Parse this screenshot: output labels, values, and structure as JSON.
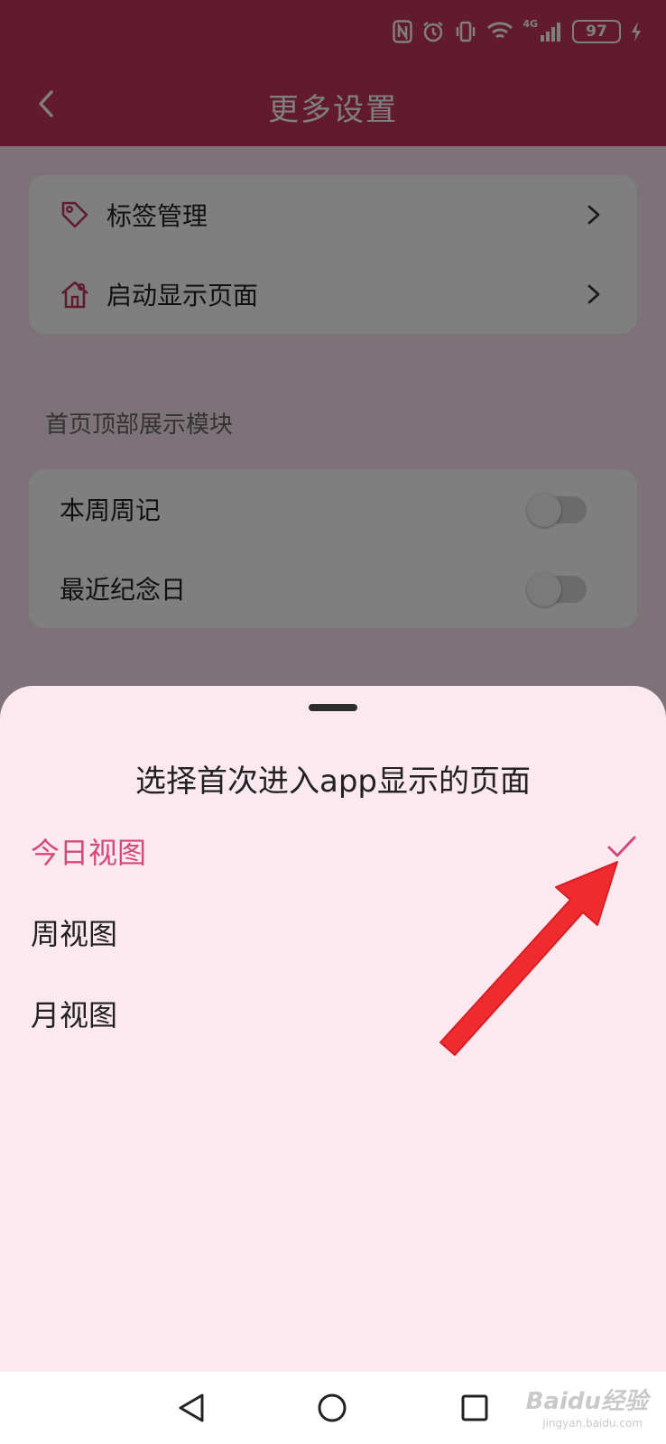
{
  "status_bar": {
    "battery": "97",
    "network": "4G",
    "icons": [
      "nfc-icon",
      "alarm-icon",
      "vibrate-icon",
      "wifi-icon",
      "signal-icon",
      "battery-icon",
      "charging-icon"
    ]
  },
  "header": {
    "title": "更多设置",
    "back_icon": "chevron-left-icon",
    "background_color": "#c4345e"
  },
  "settings_card": {
    "items": [
      {
        "label": "标签管理",
        "icon": "tag-icon"
      },
      {
        "label": "启动显示页面",
        "icon": "home-icon"
      }
    ]
  },
  "top_modules": {
    "section_label": "首页顶部展示模块",
    "items": [
      {
        "label": "本周周记",
        "enabled": false
      },
      {
        "label": "最近纪念日",
        "enabled": false
      }
    ]
  },
  "sheet": {
    "title": "选择首次进入app显示的页面",
    "options": [
      {
        "label": "今日视图",
        "selected": true
      },
      {
        "label": "周视图",
        "selected": false
      },
      {
        "label": "月视图",
        "selected": false
      }
    ],
    "accent_color": "#d4497a"
  },
  "nav_bar": {
    "buttons": [
      "back-triangle-icon",
      "home-circle-icon",
      "recents-square-icon"
    ]
  },
  "watermark": {
    "text": "Baidu经验",
    "sub": "jingyan.baidu.com"
  }
}
